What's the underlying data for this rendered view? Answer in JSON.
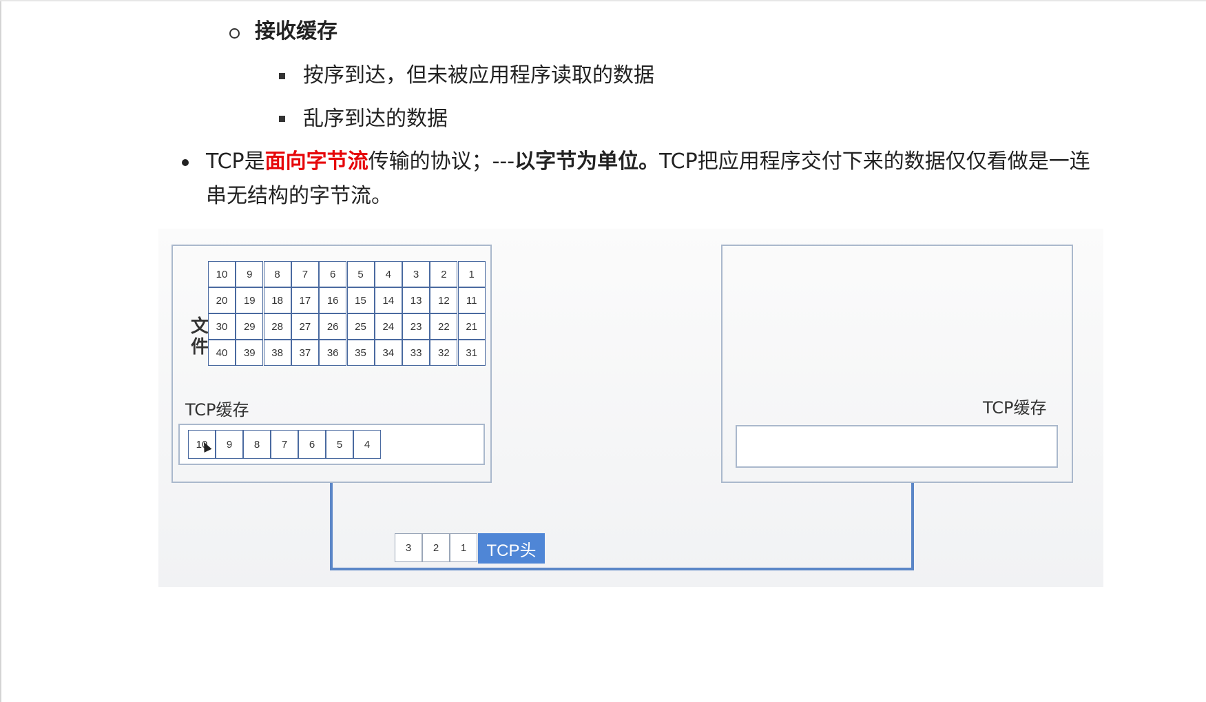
{
  "receive_buffer": {
    "title": "接收缓存",
    "items": [
      "按序到达，但未被应用程序读取的数据",
      "乱序到达的数据"
    ]
  },
  "tcp_point": {
    "prefix": "TCP是",
    "highlight": "面向字节流",
    "middle": "传输的协议；---",
    "emphasis": "以字节为单位。",
    "rest_line1": "TCP把应用程序交付下来的数据仅仅看做是一连",
    "line2": "串无结构的字节流。"
  },
  "figure": {
    "file_label": "文件",
    "file_grid": [
      [
        "10",
        "9",
        "8",
        "7",
        "6",
        "5",
        "4",
        "3",
        "2",
        "1"
      ],
      [
        "20",
        "19",
        "18",
        "17",
        "16",
        "15",
        "14",
        "13",
        "12",
        "11"
      ],
      [
        "30",
        "29",
        "28",
        "27",
        "26",
        "25",
        "24",
        "23",
        "22",
        "21"
      ],
      [
        "40",
        "39",
        "38",
        "37",
        "36",
        "35",
        "34",
        "33",
        "32",
        "31"
      ]
    ],
    "sender_buffer_label": "TCP缓存",
    "sender_buffer_cells": [
      "10",
      "9",
      "8",
      "7",
      "6",
      "5",
      "4"
    ],
    "receiver_buffer_label": "TCP缓存",
    "packet_cells": [
      "3",
      "2",
      "1"
    ],
    "packet_header": "TCP头"
  },
  "colors": {
    "highlight": "#e6060a",
    "header": "#4f86d6",
    "wire": "#5b86c7",
    "grid_border": "#4a6aa0"
  }
}
